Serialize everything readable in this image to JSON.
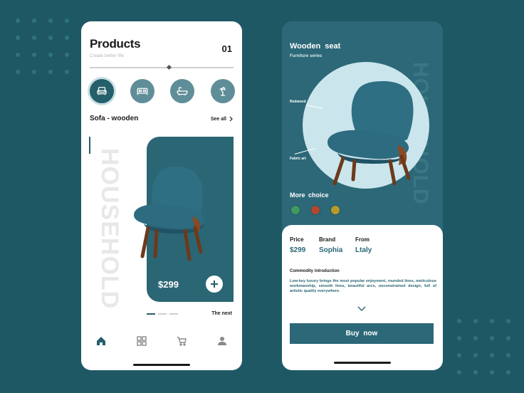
{
  "colors": {
    "background": "#1f5865",
    "teal": "#2c6877",
    "dark_teal": "#245f6b",
    "white": "#ffffff"
  },
  "left_screen": {
    "title": "Products",
    "subtitle": "Create better life",
    "page_number": "01",
    "slider_position": 0.5,
    "categories": [
      {
        "icon": "sofa-icon",
        "active": true
      },
      {
        "icon": "bed-icon",
        "active": false
      },
      {
        "icon": "bathtub-icon",
        "active": false
      },
      {
        "icon": "lamp-icon",
        "active": false
      }
    ],
    "section_title": "Sofa - wooden",
    "see_all_label": "See all",
    "vertical_text": "HOUSEHOLD",
    "product_price": "$299",
    "next_label": "The next",
    "nav_items": [
      "home-icon",
      "grid-icon",
      "cart-icon",
      "user-icon"
    ]
  },
  "right_screen": {
    "title": "Wooden seat",
    "subtitle": "Furniture series",
    "vertical_text": "HOUSEHOLD",
    "callouts": [
      "Redwood",
      "Fabric art"
    ],
    "more_choice_label": "More choice",
    "swatches": [
      "#3f9a5c",
      "#b2472e",
      "#b89a2a"
    ],
    "specs": [
      {
        "label": "Price",
        "value": "$299"
      },
      {
        "label": "Brand",
        "value": "Sophia"
      },
      {
        "label": "From",
        "value": "Ltaly"
      }
    ],
    "intro_title": "Commodity introduction",
    "intro_body": "Low-key luxury brings the most popular enjoyment, rounded lines, meticulous workmanship, smooth lines, beautiful arcs, unconstrained design, full of artistic quality everywhere.",
    "buy_label": "Buy now"
  }
}
